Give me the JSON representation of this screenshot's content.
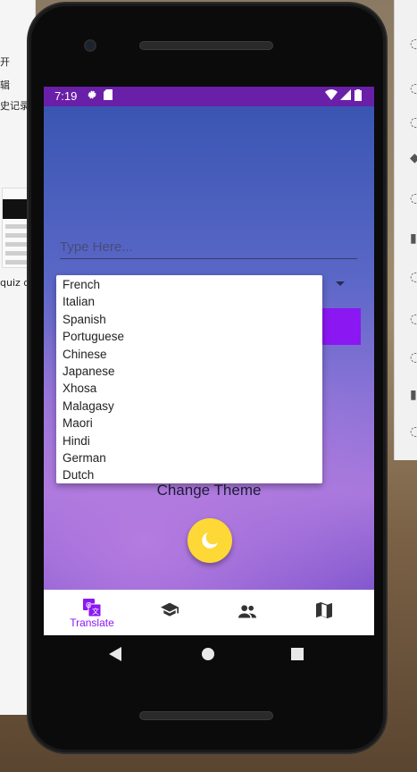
{
  "background": {
    "left_window_text": [
      "开",
      "辑",
      "史记录",
      "quiz d"
    ]
  },
  "status_bar": {
    "time": "7:19",
    "color": "#6a1fa8"
  },
  "app": {
    "input": {
      "placeholder": "Type Here...",
      "value": ""
    },
    "dropdown": {
      "options": [
        "French",
        "Italian",
        "Spanish",
        "Portuguese",
        "Chinese",
        "Japanese",
        "Xhosa",
        "Malagasy",
        "Maori",
        "Hindi",
        "German",
        "Dutch"
      ]
    },
    "translate_button_color": "#8b17f2",
    "change_theme_label": "Change Theme",
    "theme_fab_icon": "moon-icon",
    "fab_color": "#fdd836"
  },
  "bottom_nav": {
    "items": [
      {
        "label": "Translate",
        "icon": "translate-icon",
        "active": true
      },
      {
        "label": "",
        "icon": "school-icon",
        "active": false
      },
      {
        "label": "",
        "icon": "people-icon",
        "active": false
      },
      {
        "label": "",
        "icon": "map-icon",
        "active": false
      }
    ],
    "active_color": "#8b17f2"
  }
}
